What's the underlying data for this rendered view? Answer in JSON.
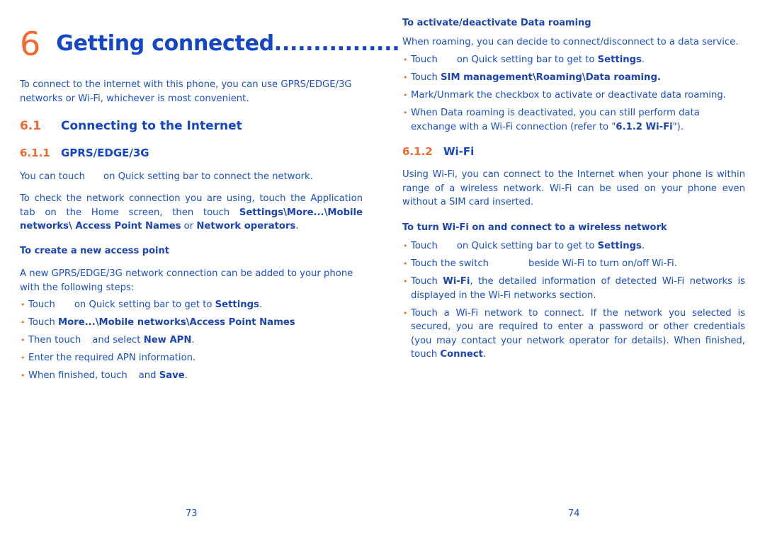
{
  "left_page": {
    "chapter_number": "6",
    "chapter_title": "Getting connected................",
    "intro": "To connect to the internet with this phone, you can use GPRS/EDGE/3G networks or Wi-Fi, whichever is most convenient.",
    "section": {
      "number": "6.1",
      "title": "Connecting to the Internet"
    },
    "subsection": {
      "number": "6.1.1",
      "title": "GPRS/EDGE/3G"
    },
    "p1": {
      "a": "You can touch",
      "b": "on Quick setting bar to connect the network."
    },
    "p2": {
      "a": "To check the network connection you are using, touch the Application tab on the Home screen, then touch ",
      "b1": "Settings\\More...\\Mobile networks\\ Access Point Names",
      "c": " or ",
      "b2": "Network operators",
      "d": "."
    },
    "create_heading": "To create a new access point",
    "create_intro": "A new GPRS/EDGE/3G network connection can be added to your phone with the following steps:",
    "bullets": [
      {
        "a": "Touch",
        "b": "on Quick setting bar to get to ",
        "bold": "Settings",
        "c": "."
      },
      {
        "a": "Touch ",
        "bold": "More...\\Mobile networks\\Access Point Names"
      },
      {
        "a": "Then touch",
        "b": "and select ",
        "bold": "New APN",
        "c": "."
      },
      {
        "a": "Enter the required APN information."
      },
      {
        "a": "When finished, touch",
        "b": "and ",
        "bold": "Save",
        "c": "."
      }
    ],
    "page_number": "73"
  },
  "right_page": {
    "roaming_heading": "To activate/deactivate Data roaming",
    "roaming_intro": "When roaming, you can decide to connect/disconnect to a data service.",
    "roaming_bullets": [
      {
        "a": "Touch",
        "b": "on Quick setting bar to get to ",
        "bold": "Settings",
        "c": "."
      },
      {
        "a": "Touch ",
        "bold": "SIM management\\Roaming\\Data roaming."
      },
      {
        "a": "Mark/Unmark the checkbox to activate or deactivate data roaming."
      },
      {
        "a": "When Data roaming is deactivated, you can still perform data exchange with a Wi-Fi connection (refer to \"",
        "bold": "6.1.2 Wi-Fi",
        "c": "\")."
      }
    ],
    "subsection": {
      "number": "6.1.2",
      "title": "Wi-Fi"
    },
    "wifi_intro": "Using Wi-Fi, you can connect to the Internet when your phone is within range of a wireless network. Wi-Fi can be used on your phone even without a SIM card inserted.",
    "wifi_heading": "To turn Wi-Fi on and connect to a wireless network",
    "wifi_bullets": [
      {
        "a": "Touch",
        "b": "on Quick setting bar to get to ",
        "bold": "Settings",
        "c": "."
      },
      {
        "a": "Touch the switch",
        "b": "beside Wi-Fi to turn on/off Wi-Fi."
      },
      {
        "a": "Touch ",
        "bold": "Wi-Fi",
        "c": ", the detailed information of detected Wi-Fi networks is displayed in the Wi-Fi networks section."
      },
      {
        "a": "Touch a Wi-Fi network to connect. If the network you selected is secured, you are required to enter a password or other credentials (you may contact your network operator for details). When finished, touch ",
        "bold": "Connect",
        "c": "."
      }
    ],
    "page_number": "74"
  },
  "colors": {
    "accent_orange": "#f26a2e",
    "heading_blue": "#1446c8",
    "text_blue": "#1a4fd0"
  }
}
